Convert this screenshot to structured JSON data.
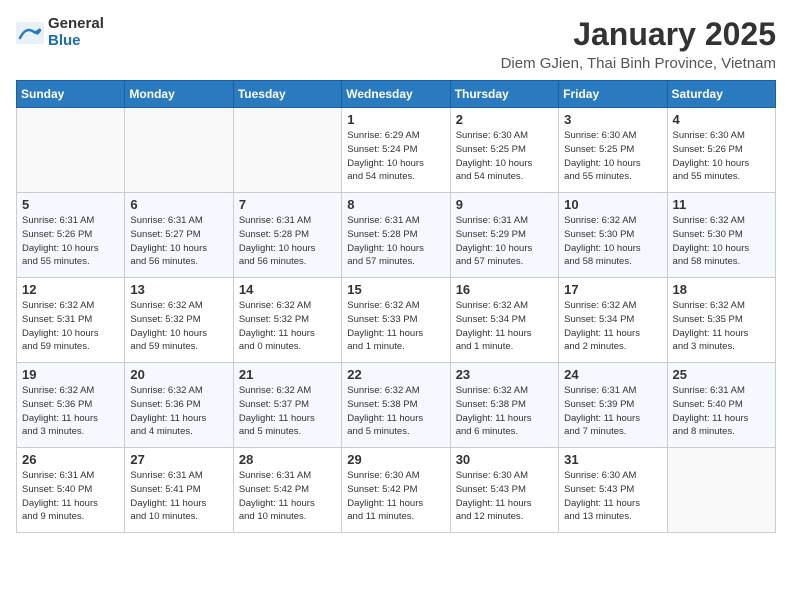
{
  "logo": {
    "general": "General",
    "blue": "Blue"
  },
  "header": {
    "title": "January 2025",
    "subtitle": "Diem GJien, Thai Binh Province, Vietnam"
  },
  "weekdays": [
    "Sunday",
    "Monday",
    "Tuesday",
    "Wednesday",
    "Thursday",
    "Friday",
    "Saturday"
  ],
  "weeks": [
    [
      {
        "day": "",
        "info": ""
      },
      {
        "day": "",
        "info": ""
      },
      {
        "day": "",
        "info": ""
      },
      {
        "day": "1",
        "info": "Sunrise: 6:29 AM\nSunset: 5:24 PM\nDaylight: 10 hours\nand 54 minutes."
      },
      {
        "day": "2",
        "info": "Sunrise: 6:30 AM\nSunset: 5:25 PM\nDaylight: 10 hours\nand 54 minutes."
      },
      {
        "day": "3",
        "info": "Sunrise: 6:30 AM\nSunset: 5:25 PM\nDaylight: 10 hours\nand 55 minutes."
      },
      {
        "day": "4",
        "info": "Sunrise: 6:30 AM\nSunset: 5:26 PM\nDaylight: 10 hours\nand 55 minutes."
      }
    ],
    [
      {
        "day": "5",
        "info": "Sunrise: 6:31 AM\nSunset: 5:26 PM\nDaylight: 10 hours\nand 55 minutes."
      },
      {
        "day": "6",
        "info": "Sunrise: 6:31 AM\nSunset: 5:27 PM\nDaylight: 10 hours\nand 56 minutes."
      },
      {
        "day": "7",
        "info": "Sunrise: 6:31 AM\nSunset: 5:28 PM\nDaylight: 10 hours\nand 56 minutes."
      },
      {
        "day": "8",
        "info": "Sunrise: 6:31 AM\nSunset: 5:28 PM\nDaylight: 10 hours\nand 57 minutes."
      },
      {
        "day": "9",
        "info": "Sunrise: 6:31 AM\nSunset: 5:29 PM\nDaylight: 10 hours\nand 57 minutes."
      },
      {
        "day": "10",
        "info": "Sunrise: 6:32 AM\nSunset: 5:30 PM\nDaylight: 10 hours\nand 58 minutes."
      },
      {
        "day": "11",
        "info": "Sunrise: 6:32 AM\nSunset: 5:30 PM\nDaylight: 10 hours\nand 58 minutes."
      }
    ],
    [
      {
        "day": "12",
        "info": "Sunrise: 6:32 AM\nSunset: 5:31 PM\nDaylight: 10 hours\nand 59 minutes."
      },
      {
        "day": "13",
        "info": "Sunrise: 6:32 AM\nSunset: 5:32 PM\nDaylight: 10 hours\nand 59 minutes."
      },
      {
        "day": "14",
        "info": "Sunrise: 6:32 AM\nSunset: 5:32 PM\nDaylight: 11 hours\nand 0 minutes."
      },
      {
        "day": "15",
        "info": "Sunrise: 6:32 AM\nSunset: 5:33 PM\nDaylight: 11 hours\nand 1 minute."
      },
      {
        "day": "16",
        "info": "Sunrise: 6:32 AM\nSunset: 5:34 PM\nDaylight: 11 hours\nand 1 minute."
      },
      {
        "day": "17",
        "info": "Sunrise: 6:32 AM\nSunset: 5:34 PM\nDaylight: 11 hours\nand 2 minutes."
      },
      {
        "day": "18",
        "info": "Sunrise: 6:32 AM\nSunset: 5:35 PM\nDaylight: 11 hours\nand 3 minutes."
      }
    ],
    [
      {
        "day": "19",
        "info": "Sunrise: 6:32 AM\nSunset: 5:36 PM\nDaylight: 11 hours\nand 3 minutes."
      },
      {
        "day": "20",
        "info": "Sunrise: 6:32 AM\nSunset: 5:36 PM\nDaylight: 11 hours\nand 4 minutes."
      },
      {
        "day": "21",
        "info": "Sunrise: 6:32 AM\nSunset: 5:37 PM\nDaylight: 11 hours\nand 5 minutes."
      },
      {
        "day": "22",
        "info": "Sunrise: 6:32 AM\nSunset: 5:38 PM\nDaylight: 11 hours\nand 5 minutes."
      },
      {
        "day": "23",
        "info": "Sunrise: 6:32 AM\nSunset: 5:38 PM\nDaylight: 11 hours\nand 6 minutes."
      },
      {
        "day": "24",
        "info": "Sunrise: 6:31 AM\nSunset: 5:39 PM\nDaylight: 11 hours\nand 7 minutes."
      },
      {
        "day": "25",
        "info": "Sunrise: 6:31 AM\nSunset: 5:40 PM\nDaylight: 11 hours\nand 8 minutes."
      }
    ],
    [
      {
        "day": "26",
        "info": "Sunrise: 6:31 AM\nSunset: 5:40 PM\nDaylight: 11 hours\nand 9 minutes."
      },
      {
        "day": "27",
        "info": "Sunrise: 6:31 AM\nSunset: 5:41 PM\nDaylight: 11 hours\nand 10 minutes."
      },
      {
        "day": "28",
        "info": "Sunrise: 6:31 AM\nSunset: 5:42 PM\nDaylight: 11 hours\nand 10 minutes."
      },
      {
        "day": "29",
        "info": "Sunrise: 6:30 AM\nSunset: 5:42 PM\nDaylight: 11 hours\nand 11 minutes."
      },
      {
        "day": "30",
        "info": "Sunrise: 6:30 AM\nSunset: 5:43 PM\nDaylight: 11 hours\nand 12 minutes."
      },
      {
        "day": "31",
        "info": "Sunrise: 6:30 AM\nSunset: 5:43 PM\nDaylight: 11 hours\nand 13 minutes."
      },
      {
        "day": "",
        "info": ""
      }
    ]
  ]
}
